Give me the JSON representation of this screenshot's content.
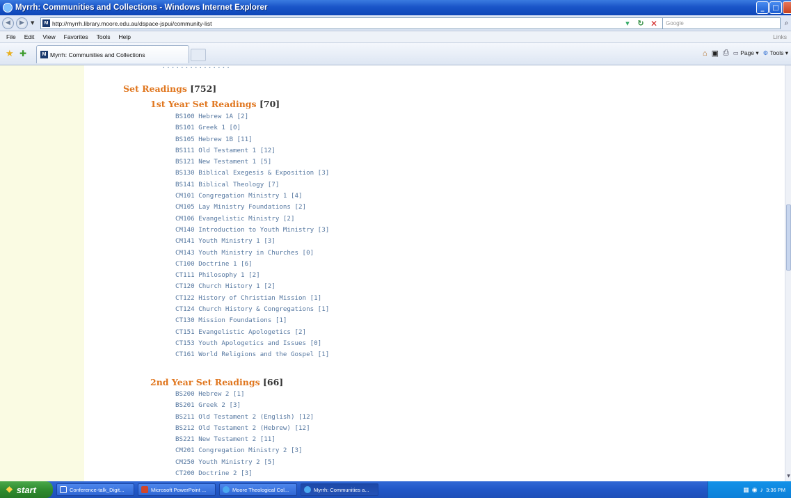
{
  "window": {
    "title": "Myrrh: Communities and Collections - Windows Internet Explorer",
    "buttons": {
      "minimize": "_",
      "maximize": "□"
    }
  },
  "address_bar": {
    "url": "http://myrrh.library.moore.edu.au/dspace-jspui/community-list",
    "search_placeholder": "Google"
  },
  "menu": {
    "items": [
      "File",
      "Edit",
      "View",
      "Favorites",
      "Tools",
      "Help"
    ],
    "links_label": "Links"
  },
  "tab": {
    "title": "Myrrh: Communities and Collections"
  },
  "command_bar": {
    "page_label": "Page ▾",
    "tools_label": "Tools ▾"
  },
  "page": {
    "cutoff_text": "...............",
    "set_readings": {
      "title": "Set Readings",
      "count": "[752]"
    },
    "year1": {
      "title": "1st Year Set Readings",
      "count": "[70]",
      "items": [
        "BS100 Hebrew 1A [2]",
        "BS101 Greek 1 [0]",
        "BS105 Hebrew 1B [11]",
        "BS111 Old Testament 1 [12]",
        "BS121 New Testament 1 [5]",
        "BS130 Biblical Exegesis & Exposition [3]",
        "BS141 Biblical Theology [7]",
        "CM101 Congregation Ministry 1 [4]",
        "CM105 Lay Ministry Foundations [2]",
        "CM106 Evangelistic Ministry [2]",
        "CM140 Introduction to Youth Ministry [3]",
        "CM141 Youth Ministry 1 [3]",
        "CM143 Youth Ministry in Churches [0]",
        "CT100 Doctrine 1 [6]",
        "CT111 Philosophy 1 [2]",
        "CT120 Church History 1 [2]",
        "CT122 History of Christian Mission [1]",
        "CT124 Church History & Congregations [1]",
        "CT130 Mission Foundations [1]",
        "CT151 Evangelistic Apologetics [2]",
        "CT153 Youth Apologetics and Issues [0]",
        "CT161 World Religions and the Gospel [1]"
      ]
    },
    "year2": {
      "title": "2nd Year Set Readings",
      "count": "[66]",
      "items": [
        "BS200 Hebrew 2 [1]",
        "BS201 Greek 2 [3]",
        "BS211 Old Testament 2 (English) [12]",
        "BS212 Old Testament 2 (Hebrew) [12]",
        "BS221 New Testament 2 [11]",
        "CM201 Congregation Ministry 2 [3]",
        "CM250 Youth Ministry 2 [5]",
        "CT200 Doctrine 2 [3]"
      ]
    }
  },
  "taskbar": {
    "start_label": "start",
    "tasks": [
      "Conference-talk_Digit...",
      "Microsoft PowerPoint ...",
      "Moore Theological Col...",
      "Myrrh: Communities a..."
    ],
    "clock": "3:36 PM"
  },
  "colors": {
    "heading_orange": "#e0761e",
    "link_blue": "#5577a0",
    "left_panel": "#fafbe3",
    "taskbar_blue": "#2157c7"
  }
}
